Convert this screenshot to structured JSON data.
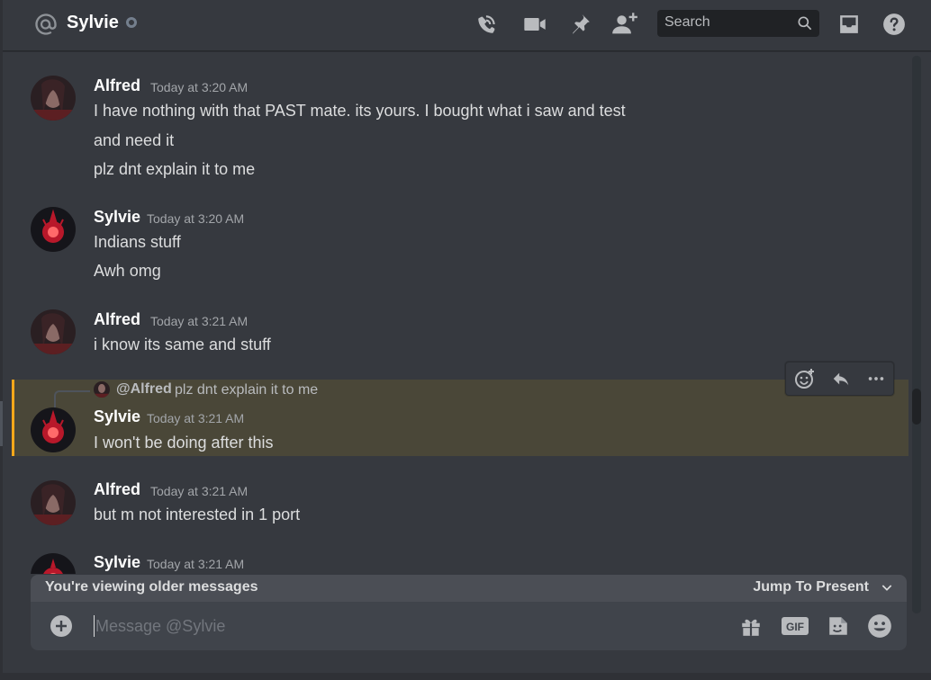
{
  "header": {
    "title": "Sylvie",
    "search_placeholder": "Search"
  },
  "messages": [
    {
      "author": "Alfred",
      "timestamp": "Today at 3:20 AM",
      "lines": [
        "I have nothing with that PAST mate. its yours. I bought what i saw and test",
        "and need it",
        "plz dnt explain it to me"
      ]
    },
    {
      "author": "Sylvie",
      "timestamp": "Today at 3:20 AM",
      "lines": [
        "Indians stuff",
        "Awh omg"
      ]
    },
    {
      "author": "Alfred",
      "timestamp": "Today at 3:21 AM",
      "lines": [
        "i know its same and stuff"
      ]
    },
    {
      "author": "Sylvie",
      "timestamp": "Today at 3:21 AM",
      "reply": {
        "mention": "@Alfred",
        "text": "plz dnt explain it to me"
      },
      "lines": [
        "I won't be doing after this"
      ]
    },
    {
      "author": "Alfred",
      "timestamp": "Today at 3:21 AM",
      "lines": [
        "but m not interested in 1 port"
      ]
    },
    {
      "author": "Sylvie",
      "timestamp": "Today at 3:21 AM",
      "lines": []
    }
  ],
  "older_bar": {
    "text": "You're viewing older messages",
    "jump_label": "Jump To Present"
  },
  "composer": {
    "placeholder": "Message @Sylvie",
    "gif_label": "GIF"
  },
  "colors": {
    "accent_highlight": "#faa81a",
    "background": "#36393f"
  }
}
